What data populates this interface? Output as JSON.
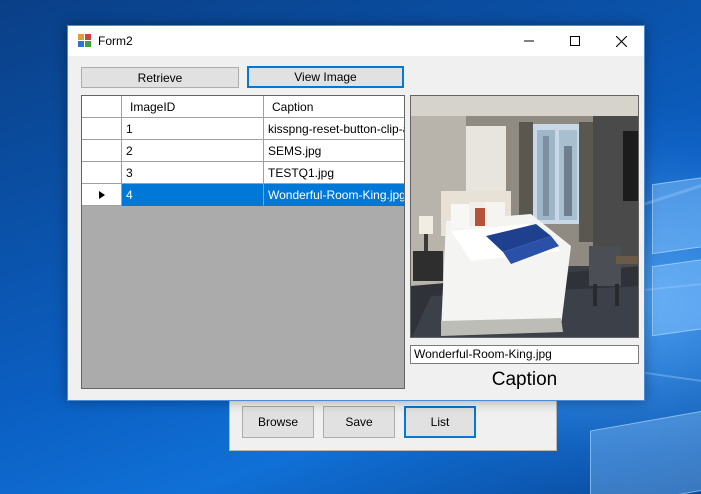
{
  "window": {
    "title": "Form2"
  },
  "toolbar": {
    "retrieve_label": "Retrieve",
    "view_image_label": "View Image"
  },
  "grid": {
    "columns": [
      "ImageID",
      "Caption"
    ],
    "rows": [
      {
        "id": "1",
        "caption": "kisspng-reset-button-clip-a..."
      },
      {
        "id": "2",
        "caption": "SEMS.jpg"
      },
      {
        "id": "3",
        "caption": "TESTQ1.jpg"
      },
      {
        "id": "4",
        "caption": "Wonderful-Room-King.jpg"
      }
    ],
    "selected_row": 4
  },
  "preview": {
    "caption_value": "Wonderful-Room-King.jpg",
    "caption_label": "Caption"
  },
  "back_form": {
    "browse_label": "Browse",
    "save_label": "Save",
    "list_label": "List"
  },
  "colors": {
    "selection": "#0078d7",
    "grid_background": "#ababab",
    "form_background": "#f0f0f0"
  }
}
